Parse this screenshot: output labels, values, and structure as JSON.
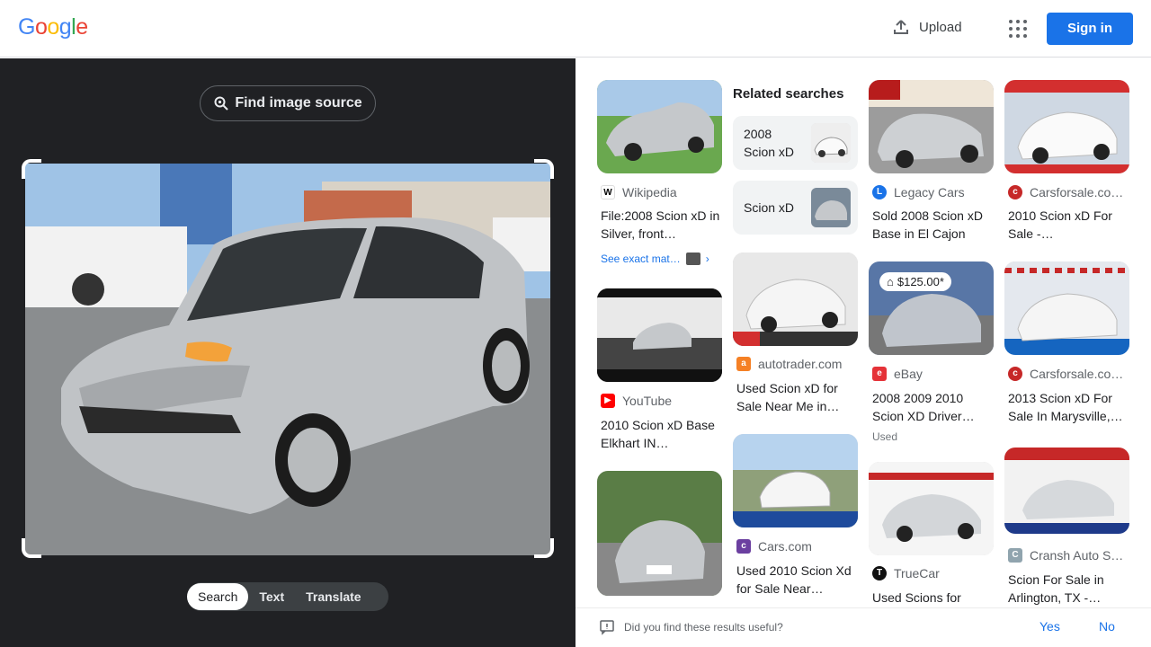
{
  "header": {
    "logo": [
      "G",
      "o",
      "o",
      "g",
      "l",
      "e"
    ],
    "logo_colors": [
      "#4285f4",
      "#ea4335",
      "#fbbc05",
      "#4285f4",
      "#34a853",
      "#ea4335"
    ],
    "upload_label": "Upload",
    "signin_label": "Sign in"
  },
  "left": {
    "find_source_label": "Find image source",
    "modes": [
      "Search",
      "Text",
      "Translate"
    ],
    "active_mode": "Search"
  },
  "related": {
    "title": "Related searches",
    "items": [
      {
        "label": "2008 Scion xD"
      },
      {
        "label": "Scion xD"
      }
    ]
  },
  "results": [
    {
      "source": "Wikipedia",
      "title": "File:2008 Scion xD in Silver, front…",
      "exact": "See exact mat…",
      "favicon_color": "#fff",
      "favicon_text": "W"
    },
    {
      "source": "YouTube",
      "title": "2010 Scion xD Base Elkhart IN…",
      "favicon_color": "#ff0000",
      "favicon_text": "▶"
    },
    {
      "source": "autotrader.com",
      "title": "Used Scion xD for Sale Near Me in…",
      "favicon_color": "#f58025",
      "favicon_text": "a"
    },
    {
      "source": "Cars.com",
      "title": "Used 2010 Scion Xd for Sale Near…",
      "favicon_color": "#6b3fa0",
      "favicon_text": "c"
    },
    {
      "source": "Legacy Cars",
      "title": "Sold 2008 Scion xD Base in El Cajon",
      "favicon_color": "#1a73e8",
      "favicon_text": "L"
    },
    {
      "source": "eBay",
      "title": "2008 2009 2010 Scion XD Driver…",
      "sub": "Used",
      "price": "$125.00*",
      "favicon_color": "#e53238",
      "favicon_text": "e"
    },
    {
      "source": "TrueCar",
      "title": "Used Scions for",
      "favicon_color": "#111",
      "favicon_text": "T"
    },
    {
      "source": "Carsforsale.co…",
      "title": "2010 Scion xD For Sale -…",
      "favicon_color": "#c62828",
      "favicon_text": "c"
    },
    {
      "source": "Carsforsale.co…",
      "title": "2013 Scion xD For Sale In Marysville,…",
      "favicon_color": "#c62828",
      "favicon_text": "c"
    },
    {
      "source": "Cransh Auto S…",
      "title": "Scion For Sale in Arlington, TX -…",
      "favicon_color": "#90a4ae",
      "favicon_text": "C"
    }
  ],
  "feedback": {
    "question": "Did you find these results useful?",
    "yes": "Yes",
    "no": "No"
  }
}
